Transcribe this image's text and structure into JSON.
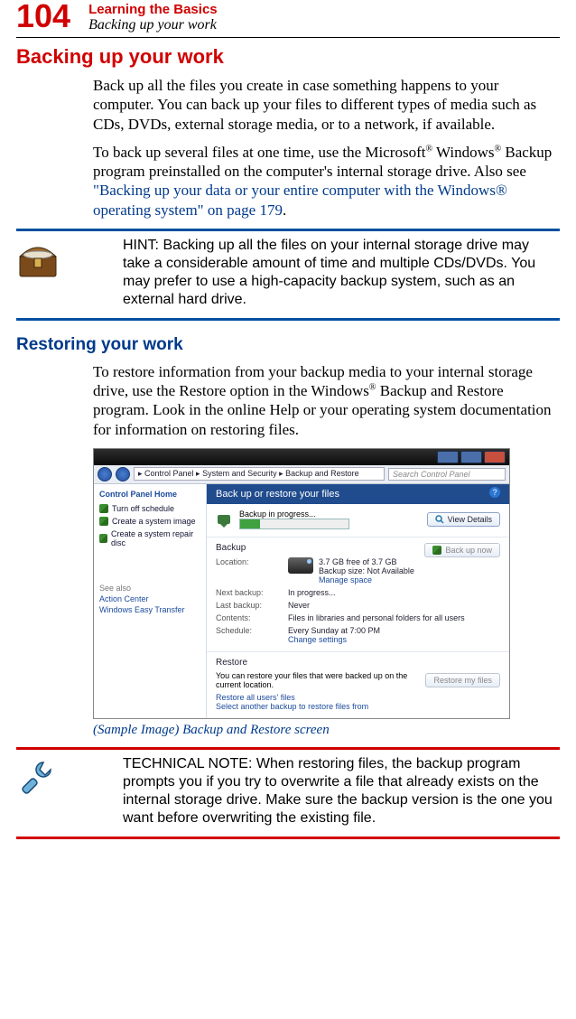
{
  "header": {
    "page_number": "104",
    "chapter": "Learning the Basics",
    "section": "Backing up your work"
  },
  "h1": "Backing up your work",
  "p1": "Back up all the files you create in case something happens to your computer. You can back up your files to different types of media such as CDs, DVDs, external storage media, or to a network, if available.",
  "p2a": "To back up several files at one time, use the Microsoft",
  "p2b": " Windows",
  "p2c": " Backup program preinstalled on the computer's internal storage drive. Also see ",
  "p2_link": "\"Backing up your data or your entire computer with the Windows® operating system\" on page 179",
  "p2d": ".",
  "hint": "HINT: Backing up all the files on your internal storage drive may take a considerable amount of time and multiple CDs/DVDs. You may prefer to use a high-capacity backup system, such as an external hard drive.",
  "h2": "Restoring your work",
  "p3a": "To restore information from your backup media to your internal storage drive, use the Restore option in the Windows",
  "p3b": " Backup and Restore program. Look in the online Help or your operating system documentation for information on restoring files.",
  "caption": "(Sample Image) Backup and Restore screen",
  "technote": "TECHNICAL NOTE: When restoring files, the backup program prompts you if you try to overwrite a file that already exists on the internal storage drive. Make sure the backup version is the one you want before overwriting the existing file.",
  "screenshot": {
    "breadcrumb": "▸ Control Panel ▸ System and Security ▸ Backup and Restore",
    "search": "Search Control Panel",
    "side_header": "Control Panel Home",
    "side_items": [
      "Turn off schedule",
      "Create a system image",
      "Create a system repair disc"
    ],
    "see_also": "See also",
    "see_also_items": [
      "Action Center",
      "Windows Easy Transfer"
    ],
    "banner": "Back up or restore your files",
    "progress_label": "Backup in progress...",
    "view_details": "View Details",
    "backup_title": "Backup",
    "backup_now": "Back up now",
    "location_label": "Location:",
    "location_value": "3.7 GB free of 3.7 GB",
    "backup_size": "Backup size: Not Available",
    "manage_space": "Manage space",
    "next_label": "Next backup:",
    "next_val": "In progress...",
    "last_label": "Last backup:",
    "last_val": "Never",
    "contents_label": "Contents:",
    "contents_val": "Files in libraries and personal folders for all users",
    "schedule_label": "Schedule:",
    "schedule_val": "Every Sunday at 7:00 PM",
    "change_settings": "Change settings",
    "restore_title": "Restore",
    "restore_desc": "You can restore your files that were backed up on the current location.",
    "restore_btn": "Restore my files",
    "restore_all": "Restore all users' files",
    "select_backup": "Select another backup to restore files from"
  }
}
